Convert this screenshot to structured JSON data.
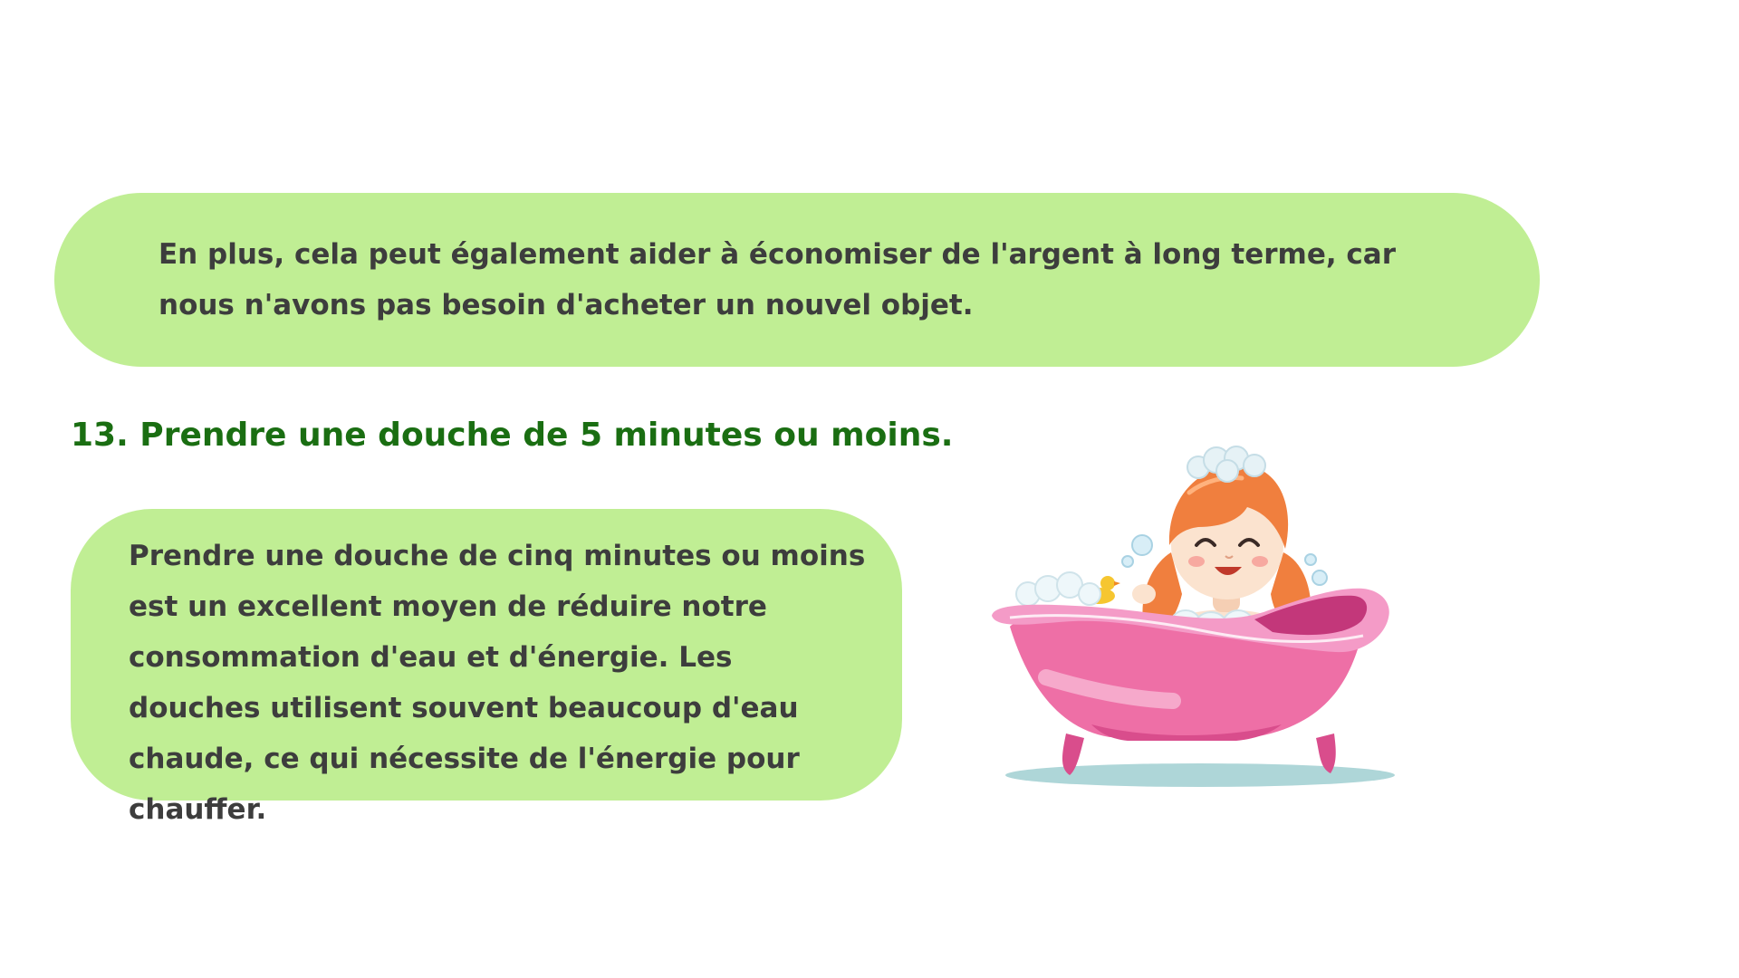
{
  "intro_bubble": {
    "text": "En plus, cela peut également aider à économiser de l'argent à long terme, car nous n'avons pas besoin d'acheter un nouvel objet."
  },
  "tip": {
    "heading": "13. Prendre une douche de 5 minutes ou moins.",
    "body": "Prendre une douche de cinq minutes ou moins est un excellent moyen de réduire notre consommation d'eau et d'énergie. Les douches utilisent souvent beaucoup d'eau chaude, ce qui nécessite de l'énergie pour chauffer."
  },
  "colors": {
    "bubble_background": "#c0ee94",
    "heading_green": "#1a6e12",
    "body_text": "#3d3d3d",
    "bathtub_pink": "#ee6fa6",
    "hair_orange": "#f07f3e"
  },
  "illustration": {
    "icon": "girl-in-bathtub-illustration"
  }
}
